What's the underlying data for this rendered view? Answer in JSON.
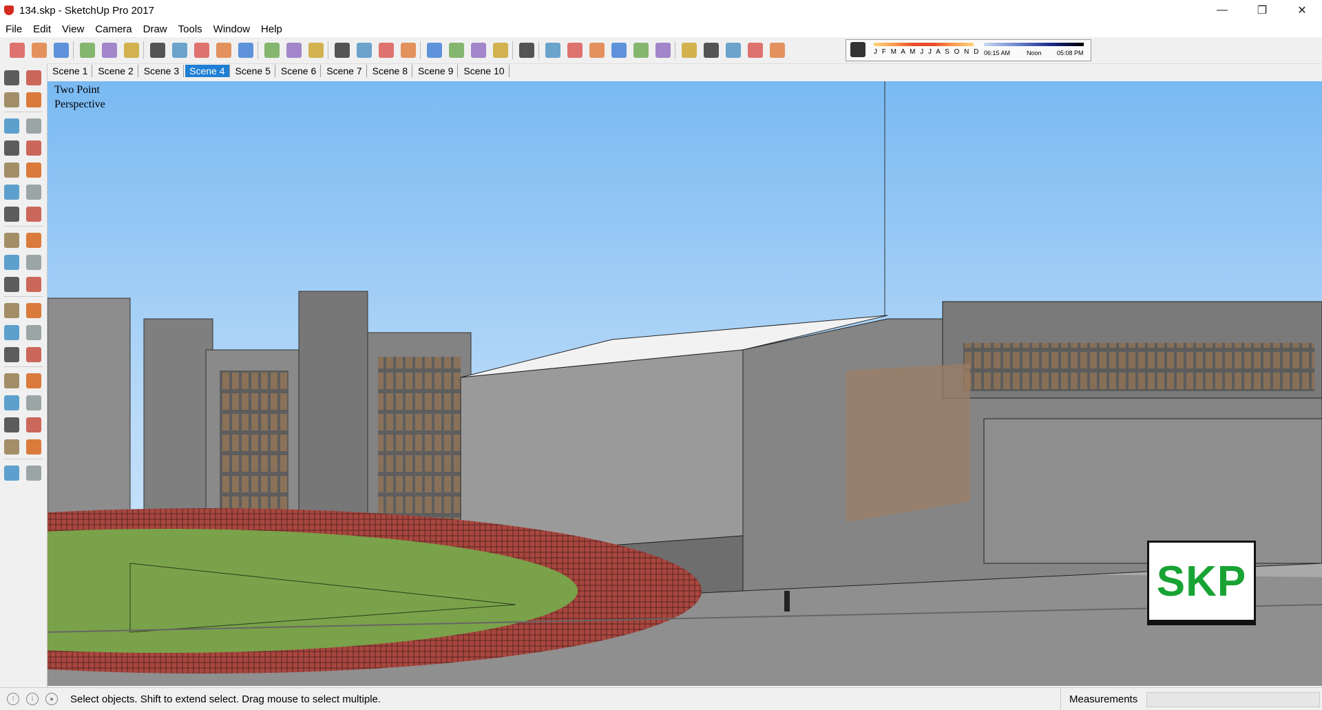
{
  "window": {
    "title": "134.skp - SketchUp Pro 2017",
    "minimize": "—",
    "maximize": "❐",
    "close": "✕"
  },
  "menu": [
    "File",
    "Edit",
    "View",
    "Camera",
    "Draw",
    "Tools",
    "Window",
    "Help"
  ],
  "scenes": [
    "Scene 1",
    "Scene 2",
    "Scene 3",
    "Scene 4",
    "Scene 5",
    "Scene 6",
    "Scene 7",
    "Scene 8",
    "Scene 9",
    "Scene 10"
  ],
  "active_scene": "Scene 4",
  "shadow": {
    "months": "J F M A M J J A S O N D",
    "sunrise": "06:15 AM",
    "noon": "Noon",
    "sunset": "05:08 PM"
  },
  "viewport": {
    "label_line1": "Two Point",
    "label_line2": "Perspective",
    "watermark": "SKP"
  },
  "status": {
    "hint": "Select objects. Shift to extend select. Drag mouse to select multiple.",
    "measurements_label": "Measurements",
    "measurements_value": ""
  },
  "colors": {
    "sky_top": "#79b9f2",
    "sky_bottom": "#d6e9fb",
    "grass": "#7aa24a",
    "track": "#a8473f",
    "building": "#8c8c8c",
    "accent": "#1e7fd4",
    "skp_green": "#18a334"
  },
  "icons": {
    "toolbar": [
      "select-icon",
      "eraser-icon",
      "line-icon",
      "arc-icon",
      "rectangle-icon",
      "push-pull-icon",
      "follow-me-icon",
      "move-icon",
      "rotate-icon",
      "scale-icon",
      "tape-measure-icon",
      "text-icon",
      "paint-bucket-icon",
      "orbit-icon",
      "pan-icon",
      "zoom-icon",
      "zoom-extents-icon",
      "warehouse-icon",
      "extension-warehouse-icon",
      "send-to-layout-icon",
      "ruby-icon",
      "xray-icon",
      "back-edges-icon",
      "wireframe-icon",
      "hidden-line-icon",
      "shaded-icon",
      "shaded-textures-icon",
      "monochrome-icon",
      "iso-view-icon",
      "top-view-icon",
      "front-view-icon",
      "right-view-icon",
      "back-view-icon",
      "left-view-icon",
      "shadows-toggle-icon"
    ],
    "left": [
      "select-icon",
      "make-component-icon",
      "paint-bucket-icon",
      "eraser-icon",
      "line-icon",
      "freehand-icon",
      "rectangle-icon",
      "rotated-rectangle-icon",
      "circle-icon",
      "polygon-icon",
      "arc-icon",
      "two-point-arc-icon",
      "three-point-arc-icon",
      "pie-icon",
      "move-icon",
      "push-pull-icon",
      "rotate-icon",
      "follow-me-icon",
      "scale-icon",
      "offset-icon",
      "tape-measure-icon",
      "dimension-icon",
      "protractor-icon",
      "text-icon",
      "axes-icon",
      "3d-text-icon",
      "orbit-icon",
      "pan-icon",
      "zoom-icon",
      "zoom-window-icon",
      "zoom-extents-icon",
      "previous-view-icon",
      "position-camera-icon",
      "look-around-icon",
      "walk-icon",
      "section-plane-icon"
    ]
  }
}
